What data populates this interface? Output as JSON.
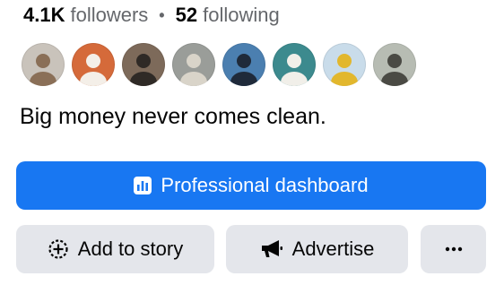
{
  "stats": {
    "followers_count": "4.1K",
    "followers_label": "followers",
    "separator": "•",
    "following_count": "52",
    "following_label": "following"
  },
  "followers_preview": {
    "avatars": [
      {
        "icon": "follower-avatar-1",
        "bg": "#c9c3bb",
        "fg": "#8a6f57"
      },
      {
        "icon": "follower-avatar-2",
        "bg": "#d56a3a",
        "fg": "#f4efe8"
      },
      {
        "icon": "follower-avatar-3",
        "bg": "#7d6a5a",
        "fg": "#2f2a26"
      },
      {
        "icon": "follower-avatar-4",
        "bg": "#9a9d99",
        "fg": "#d9d4c9"
      },
      {
        "icon": "follower-avatar-5",
        "bg": "#4b7fb0",
        "fg": "#1f2a3a"
      },
      {
        "icon": "follower-avatar-6",
        "bg": "#3c8a8e",
        "fg": "#f1efe9"
      },
      {
        "icon": "follower-avatar-7",
        "bg": "#c9dcea",
        "fg": "#e2b72d"
      },
      {
        "icon": "follower-avatar-8",
        "bg": "#b7bcb3",
        "fg": "#4a4a44"
      }
    ]
  },
  "bio": {
    "text": "Big money never comes clean."
  },
  "actions": {
    "professional_dashboard_label": "Professional dashboard",
    "professional_dashboard_icon": "dashboard-icon",
    "add_to_story_label": "Add to story",
    "add_to_story_icon": "add-story-icon",
    "advertise_label": "Advertise",
    "advertise_icon": "megaphone-icon",
    "more_icon": "more-icon"
  },
  "colors": {
    "primary": "#1877f2",
    "secondary_bg": "#e4e6eb",
    "muted_text": "#65676b",
    "text": "#050505"
  }
}
